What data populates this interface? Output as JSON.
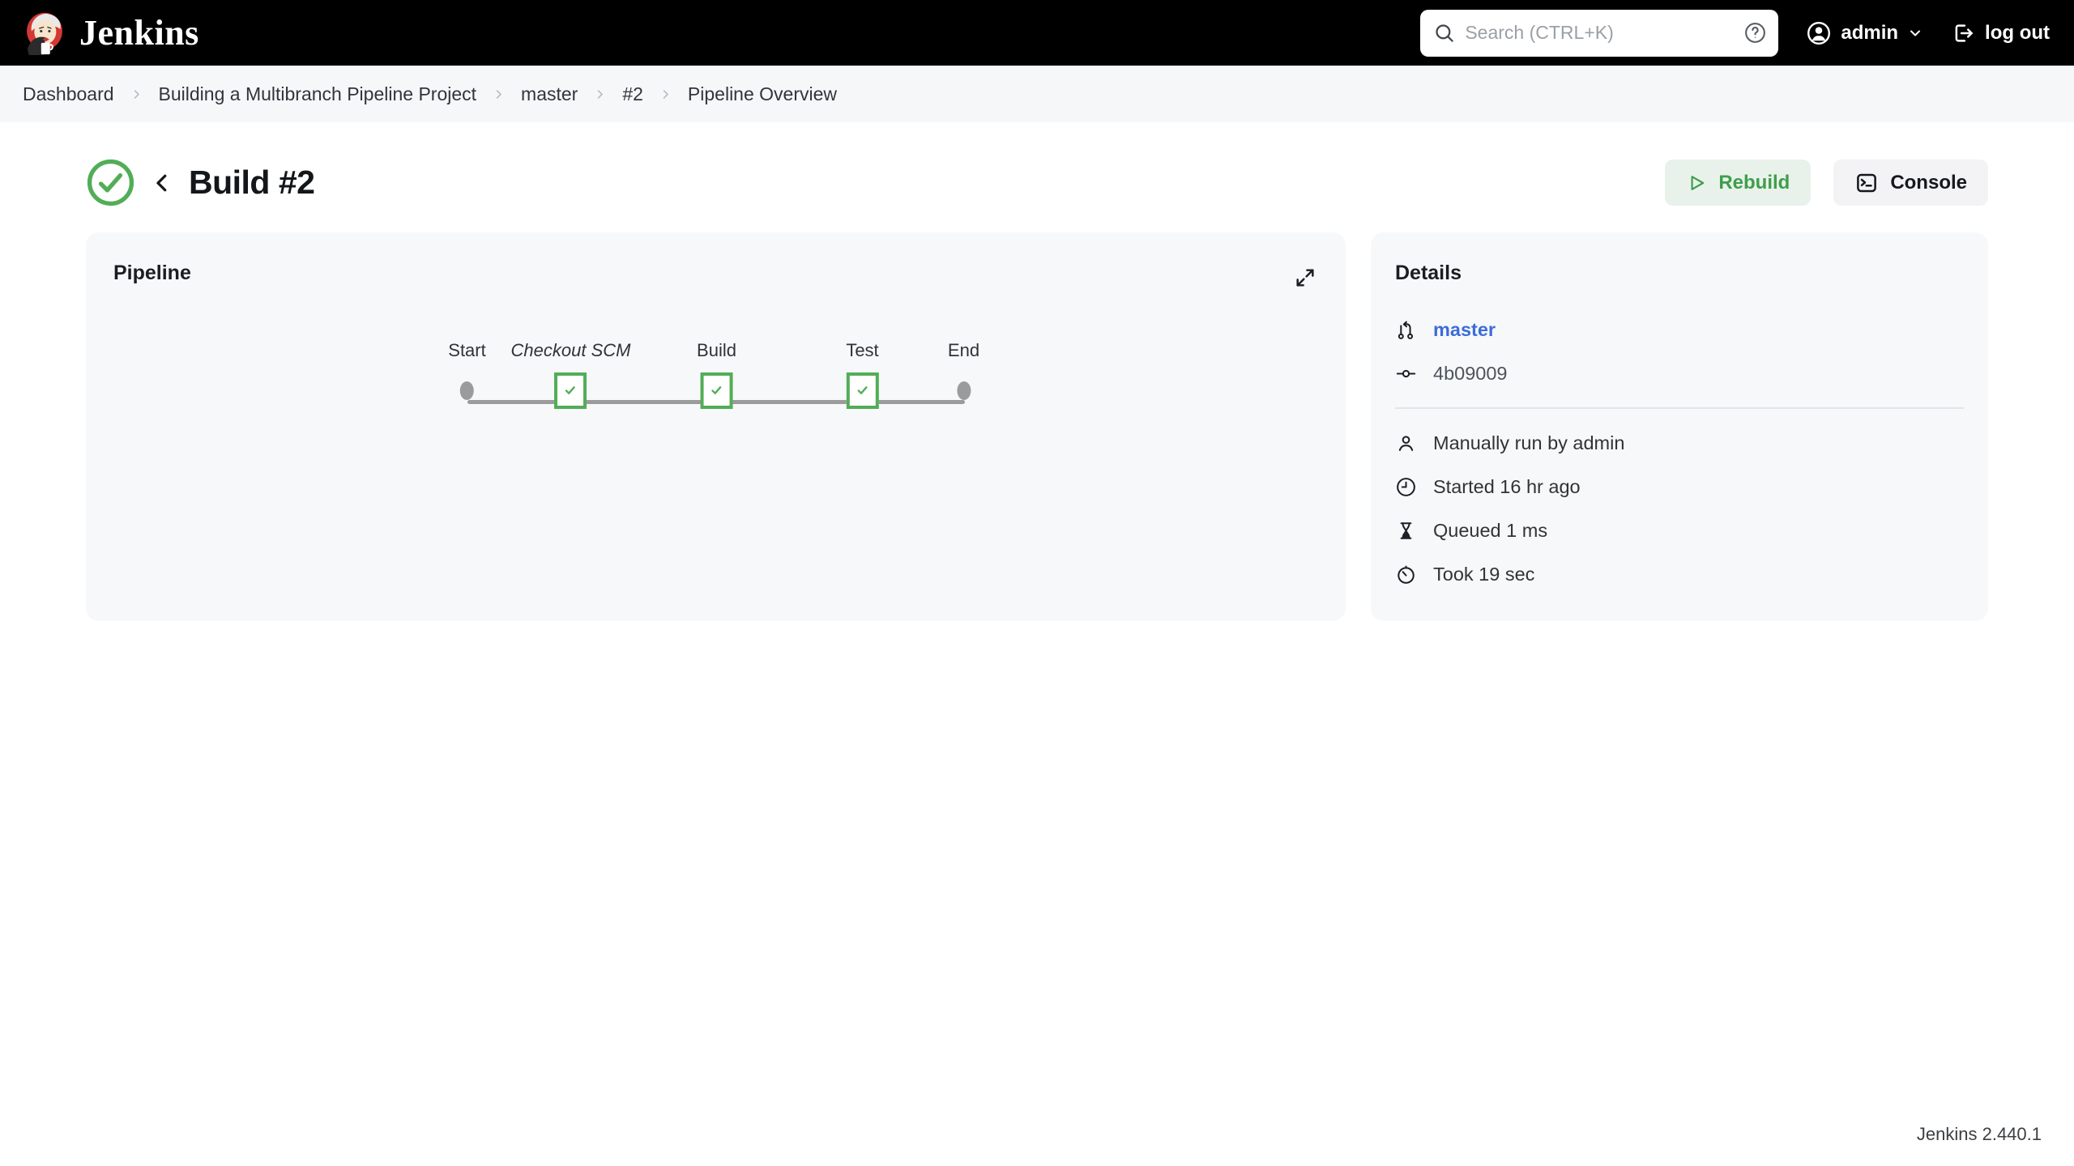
{
  "masthead": {
    "brand": "Jenkins",
    "search_placeholder": "Search (CTRL+K)",
    "user": "admin",
    "logout_label": "log out"
  },
  "breadcrumb": {
    "items": [
      "Dashboard",
      "Building a Multibranch Pipeline Project",
      "master",
      "#2",
      "Pipeline Overview"
    ]
  },
  "page": {
    "title": "Build #2",
    "status": "success",
    "rebuild_label": "Rebuild",
    "console_label": "Console"
  },
  "pipeline": {
    "title": "Pipeline",
    "stages": [
      {
        "label": "Start",
        "type": "terminal"
      },
      {
        "label": "Checkout SCM",
        "type": "success",
        "italic": true
      },
      {
        "label": "Build",
        "type": "success"
      },
      {
        "label": "Test",
        "type": "success"
      },
      {
        "label": "End",
        "type": "terminal"
      }
    ]
  },
  "details": {
    "title": "Details",
    "branch": "master",
    "commit": "4b09009",
    "rows": [
      "Manually run by admin",
      "Started 16 hr ago",
      "Queued 1 ms",
      "Took 19 sec"
    ]
  },
  "footer": {
    "version": "Jenkins 2.440.1"
  },
  "colors": {
    "success_green": "#52ad57",
    "link_blue": "#3b6cd9",
    "rebuild_bg": "#e9f2ea",
    "masthead_bg": "#000000",
    "card_bg": "#f7f8fa"
  }
}
